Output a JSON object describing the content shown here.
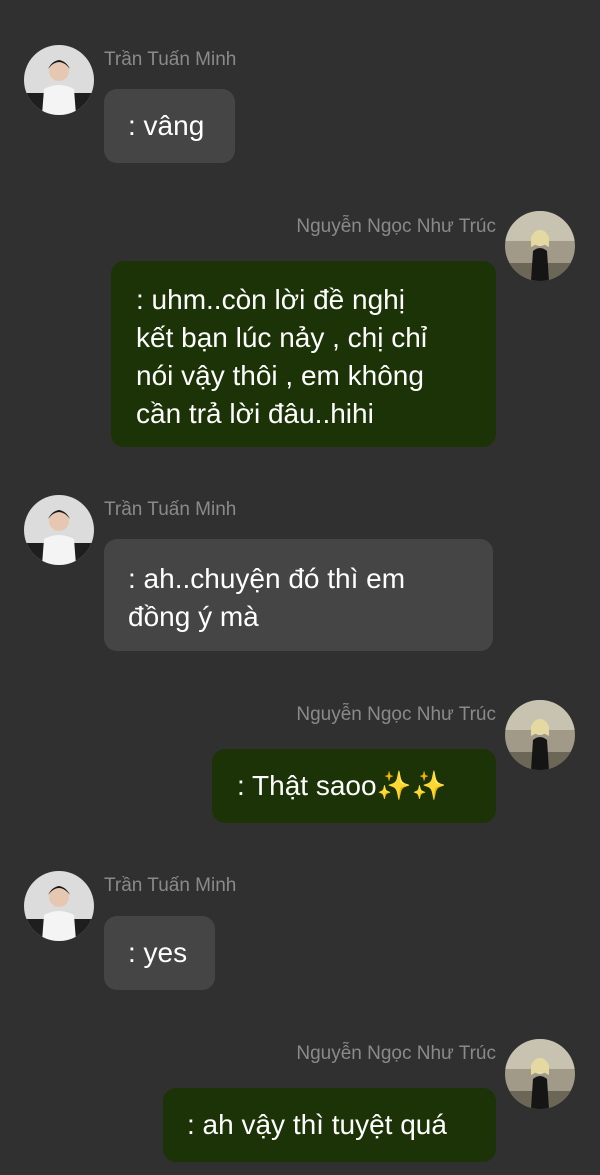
{
  "participants": {
    "left": {
      "name": "Trần Tuấn Minh",
      "avatar_icon": "male-user-avatar-icon"
    },
    "right": {
      "name": "Nguyễn Ngọc Như Trúc",
      "avatar_icon": "female-user-avatar-icon"
    }
  },
  "messages": [
    {
      "sender": "Trần Tuấn Minh",
      "side": "left",
      "lines": [
        ": vâng"
      ]
    },
    {
      "sender": "Nguyễn Ngọc Như Trúc",
      "side": "right",
      "lines": [
        ": uhm..còn lời đề nghị",
        "kết bạn lúc nảy , chị chỉ",
        "nói vậy thôi , em không",
        "cần trả lời đâu..hihi"
      ]
    },
    {
      "sender": "Trần Tuấn Minh",
      "side": "left",
      "lines": [
        ": ah..chuyện đó thì em",
        "đồng ý mà"
      ]
    },
    {
      "sender": "Nguyễn Ngọc Như Trúc",
      "side": "right",
      "text": ": Thật saoo",
      "emoji": "✨✨"
    },
    {
      "sender": "Trần Tuấn Minh",
      "side": "left",
      "lines": [
        ": yes"
      ]
    },
    {
      "sender": "Nguyễn Ngọc Như Trúc",
      "side": "right",
      "lines": [
        ": ah vậy thì tuyệt quá"
      ]
    }
  ],
  "colors": {
    "background": "#303030",
    "incoming_bubble": "#454545",
    "outgoing_bubble": "#1b3306",
    "name_text": "#8a8a8a",
    "message_text": "#ffffff"
  }
}
